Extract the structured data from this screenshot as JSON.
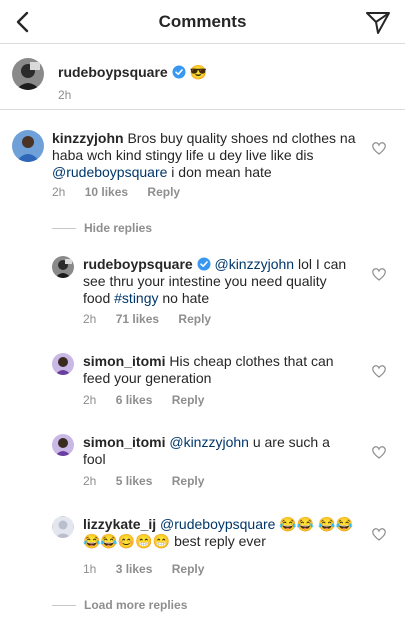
{
  "header": {
    "title": "Comments"
  },
  "caption": {
    "username": "rudeboypsquare",
    "emoji": "😎",
    "time": "2h"
  },
  "comments": [
    {
      "username": "kinzzyjohn",
      "text_1": "Bros buy quality shoes nd clothes na haba wch kind stingy life u dey live like dis ",
      "mention": "@rudeboypsquare",
      "text_2": " i don mean hate",
      "time": "2h",
      "likes": "10 likes",
      "reply": "Reply"
    }
  ],
  "hide_replies_label": "Hide replies",
  "replies": [
    {
      "username": "rudeboypsquare",
      "mention": "@kinzzyjohn",
      "text_1": " lol I can see thru your intestine you need quality food ",
      "hashtag": "#stingy",
      "text_2": " no hate",
      "time": "2h",
      "likes": "71 likes",
      "reply": "Reply"
    },
    {
      "username": "simon_itomi",
      "text": "His cheap clothes that can feed your generation",
      "time": "2h",
      "likes": "6 likes",
      "reply": "Reply"
    },
    {
      "username": "simon_itomi",
      "mention": "@kinzzyjohn",
      "text": " u are such a fool",
      "time": "2h",
      "likes": "5 likes",
      "reply": "Reply"
    },
    {
      "username": "lizzykate_ij",
      "mention": "@rudeboypsquare",
      "emoji_line_1": "😂😂",
      "emoji_line_2": "😂😂😂😂😊😁😁",
      "text": "best reply ever",
      "time": "1h",
      "likes": "3 likes",
      "reply": "Reply"
    }
  ],
  "load_more_label": "Load more replies",
  "colors": {
    "text": "#262626",
    "secondary": "#8e8e8e",
    "link": "#00376b",
    "verified": "#3897f0",
    "divider": "#dbdbdb"
  },
  "icons": {
    "back": "chevron-left-icon",
    "send": "paper-plane-icon",
    "verified": "verified-badge-icon",
    "like": "heart-outline-icon"
  }
}
